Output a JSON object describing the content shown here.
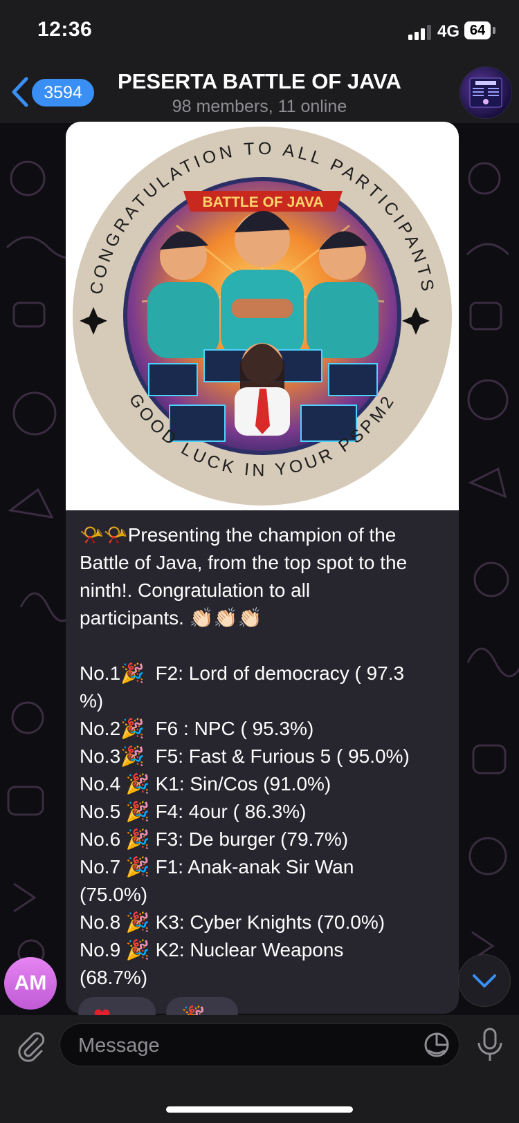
{
  "status_bar": {
    "time": "12:36",
    "network": "4G",
    "battery": "64"
  },
  "header": {
    "unread_count": "3594",
    "title": "PESERTA BATTLE OF JAVA",
    "subtitle": "98 members, 11 online"
  },
  "photo": {
    "ring_top_text": "CONGRATULATION TO ALL PARTICIPANTS",
    "ring_bottom_text": "GOOD LUCK IN YOUR PSPM2",
    "banner_text": "BATTLE OF JAVA"
  },
  "message": {
    "intro_lines": [
      "📯📯Presenting the champion of the",
      "Battle of Java, from the top spot to the",
      "ninth!. Congratulation to all",
      "participants. 👏🏻👏🏻👏🏻"
    ],
    "ranking_lines": [
      "No.1🎉  F2: Lord of democracy ( 97.3",
      "%)",
      "No.2🎉  F6 : NPC ( 95.3%)",
      "No.3🎉  F5: Fast & Furious 5 ( 95.0%)",
      "No.4 🎉 K1: Sin/Cos (91.0%)",
      "No.5 🎉 F4: 4our ( 86.3%)",
      "No.6 🎉 F3: De burger (79.7%)",
      "No.7 🎉 F1: Anak-anak Sir Wan",
      "(75.0%)",
      "No.8 🎉 K3: Cyber Knights (70.0%)",
      "No.9 🎉 K2: Nuclear Weapons",
      "(68.7%)"
    ]
  },
  "sender": {
    "initials": "AM"
  },
  "input": {
    "placeholder": "Message"
  },
  "colors": {
    "accent": "#3a8ff5",
    "bubble": "#27252e",
    "avatar": "#d86ee6"
  }
}
